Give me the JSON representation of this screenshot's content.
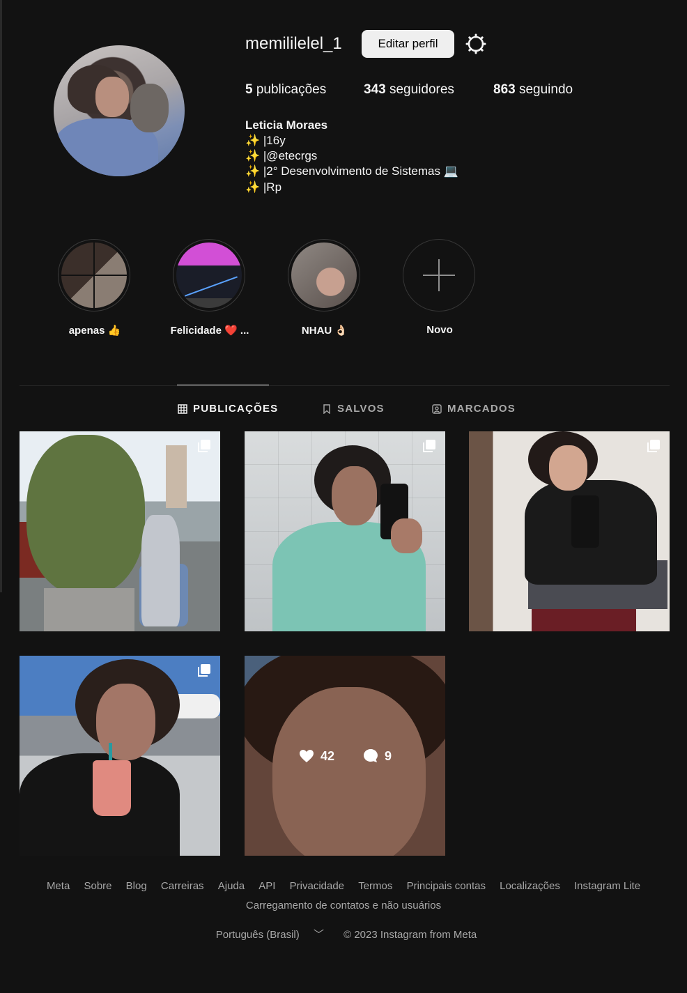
{
  "profile": {
    "username": "memililelel_1",
    "edit_label": "Editar perfil",
    "posts_count": "5",
    "posts_label": "publicações",
    "followers_count": "343",
    "followers_label": "seguidores",
    "following_count": "863",
    "following_label": "seguindo",
    "full_name": "Leticia Moraes",
    "bio": [
      "✨ |16y",
      "✨ |@etecrgs",
      "✨ |2° Desenvolvimento de Sistemas 💻",
      "✨ |Rp"
    ]
  },
  "highlights": [
    {
      "label": "apenas 👍"
    },
    {
      "label": "Felicidade ❤️ ..."
    },
    {
      "label": "NHAU 👌🏻"
    },
    {
      "label": "Novo"
    }
  ],
  "tabs": [
    {
      "label": "PUBLICAÇÕES",
      "active": true,
      "icon": "grid-icon"
    },
    {
      "label": "SALVOS",
      "active": false,
      "icon": "bookmark-icon"
    },
    {
      "label": "MARCADOS",
      "active": false,
      "icon": "tagged-icon"
    }
  ],
  "posts": [
    {
      "multi": true
    },
    {
      "multi": true
    },
    {
      "multi": true
    },
    {
      "multi": true
    },
    {
      "multi": false,
      "likes": "42",
      "comments": "9"
    }
  ],
  "footer": {
    "links": [
      "Meta",
      "Sobre",
      "Blog",
      "Carreiras",
      "Ajuda",
      "API",
      "Privacidade",
      "Termos",
      "Principais contas",
      "Localizações",
      "Instagram Lite"
    ],
    "links2": "Carregamento de contatos e não usuários",
    "language": "Português (Brasil)",
    "copyright": "© 2023 Instagram from Meta"
  }
}
